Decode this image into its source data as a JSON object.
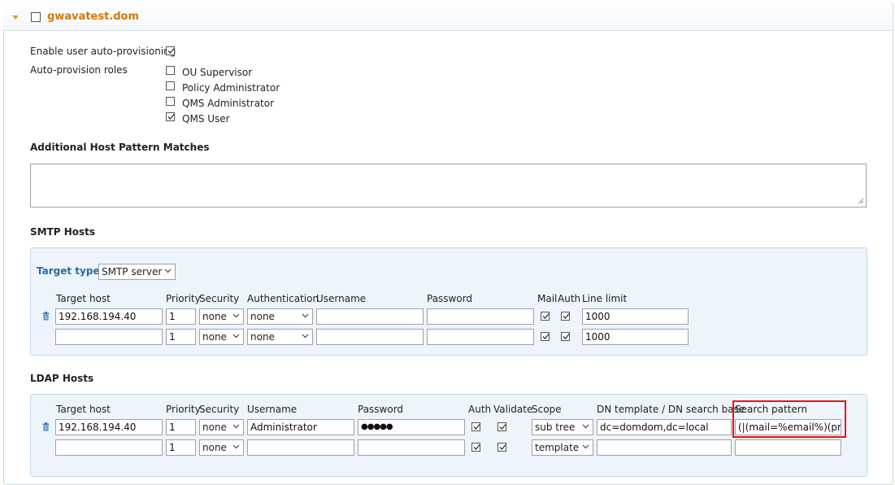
{
  "header": {
    "title": "gwavatest.dom"
  },
  "provisioning": {
    "enable_label": "Enable user auto-provisioning",
    "enable_checked": true,
    "roles_label": "Auto-provision roles",
    "roles": [
      {
        "label": "OU Supervisor",
        "checked": false
      },
      {
        "label": "Policy Administrator",
        "checked": false
      },
      {
        "label": "QMS Administrator",
        "checked": false
      },
      {
        "label": "QMS User",
        "checked": true
      }
    ]
  },
  "host_patterns": {
    "heading": "Additional Host Pattern Matches",
    "value": ""
  },
  "smtp": {
    "heading": "SMTP Hosts",
    "target_type_label": "Target type",
    "target_type_value": "SMTP server",
    "columns": {
      "target_host": "Target host",
      "priority": "Priority",
      "security": "Security",
      "authentication": "Authentication",
      "username": "Username",
      "password": "Password",
      "mail": "Mail",
      "auth": "Auth",
      "line_limit": "Line limit"
    },
    "rows": [
      {
        "target_host": "192.168.194.40",
        "priority": "1",
        "security": "none",
        "authentication": "none",
        "username": "",
        "password": "",
        "mail": true,
        "auth": true,
        "line_limit": "1000"
      },
      {
        "target_host": "",
        "priority": "1",
        "security": "none",
        "authentication": "none",
        "username": "",
        "password": "",
        "mail": true,
        "auth": true,
        "line_limit": "1000"
      }
    ]
  },
  "ldap": {
    "heading": "LDAP Hosts",
    "columns": {
      "target_host": "Target host",
      "priority": "Priority",
      "security": "Security",
      "username": "Username",
      "password": "Password",
      "auth": "Auth",
      "validate": "Validate",
      "scope": "Scope",
      "dn_template": "DN template / DN search base",
      "search_pattern": "Search pattern"
    },
    "rows": [
      {
        "target_host": "192.168.194.40",
        "priority": "1",
        "security": "none",
        "username": "Administrator",
        "password": "●●●●●",
        "auth": true,
        "validate": true,
        "scope": "sub tree",
        "dn_template": "dc=domdom,dc=local",
        "search_pattern": "(|(mail=%email%)(prox"
      },
      {
        "target_host": "",
        "priority": "1",
        "security": "none",
        "username": "",
        "password": "",
        "auth": true,
        "validate": true,
        "scope": "template",
        "dn_template": "",
        "search_pattern": ""
      }
    ]
  }
}
